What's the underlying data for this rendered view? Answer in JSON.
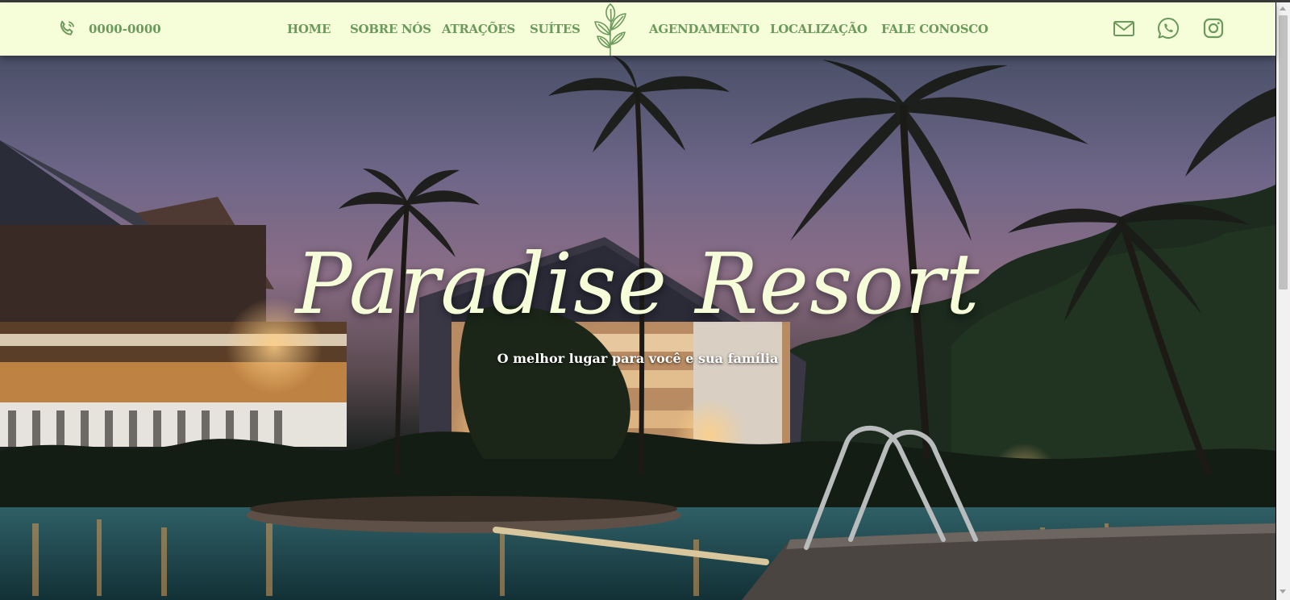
{
  "header": {
    "phone": "0000-0000",
    "nav_left": [
      "HOME",
      "SOBRE NÓS",
      "ATRAÇÕES",
      "SUÍTES"
    ],
    "nav_right": [
      "AGENDAMENTO",
      "LOCALIZAÇÃO",
      "FALE CONOSCO"
    ],
    "icons": [
      "phone-icon",
      "leaf-logo",
      "mail-icon",
      "whatsapp-icon",
      "instagram-icon"
    ]
  },
  "hero": {
    "title": "Paradise Resort",
    "subtitle": "O melhor lugar para você e sua família"
  },
  "colors": {
    "navbar_bg": "#f6fdd9",
    "nav_text": "#6c9a5c",
    "title_text": "#f6fdd9"
  }
}
